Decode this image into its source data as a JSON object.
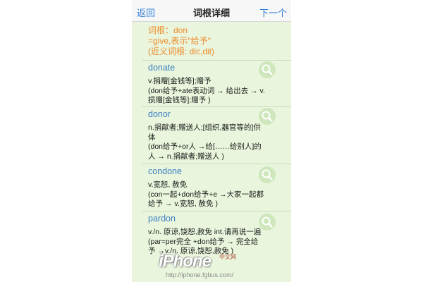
{
  "nav": {
    "back_label": "返回",
    "title": "词根详细",
    "next_label": "下一个"
  },
  "root": {
    "lines": [
      "词根：don",
      "=give,表示\"给予\"",
      "(近义词根: dic,dit)"
    ]
  },
  "entries": [
    {
      "word": "donate",
      "def_lines": [
        "v.捐赠[金钱等];赠予",
        "(don给予+ate表动词 → 给出去 → v.",
        "损赠[金钱等];赠予 )"
      ]
    },
    {
      "word": "donor",
      "def_lines": [
        "n.捐献者;赠送人;[组织,器官等的]供",
        "体",
        "(don给予+or人 →给[……给别人]的",
        "人 → n.捐献者;赠送人 )"
      ]
    },
    {
      "word": "condone",
      "def_lines": [
        "v.宽恕, 赦免",
        "(con一起+don给予+e →大家一起都",
        "给予 → v.宽恕, 赦免 )"
      ]
    },
    {
      "word": "pardon",
      "def_lines": [
        "v./n. 原谅,饶恕,赦免  int.请再说一遍",
        "(par=per完全 +don给予 → 完全给",
        "予 →v./n. 原谅,饶恕,赦免 )"
      ]
    }
  ],
  "icons": {
    "search": "search-icon"
  },
  "colors": {
    "background": "#e9f5dc",
    "root_text": "#ef8a2a",
    "word_text": "#3b7fc4",
    "nav_link": "#2e7dd7"
  },
  "watermark": {
    "brand": "iPhone",
    "tag": "中文网",
    "url": "http://iphone.fgbus.com/"
  }
}
